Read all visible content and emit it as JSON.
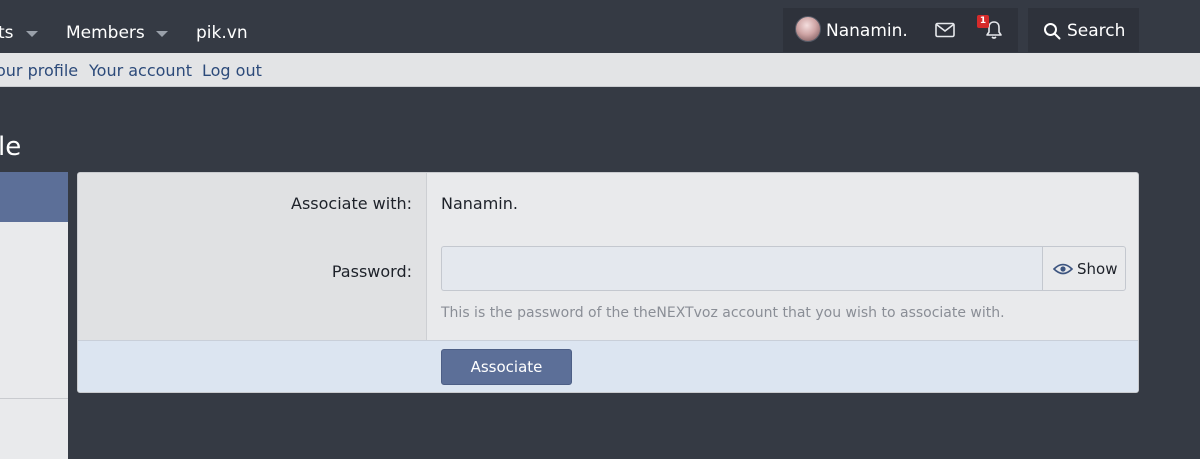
{
  "topbar": {
    "nav_items": [
      {
        "label": "ts",
        "has_dropdown": true
      },
      {
        "label": "Members",
        "has_dropdown": true
      },
      {
        "label": "pik.vn",
        "has_dropdown": false
      }
    ],
    "username": "Nanamin.",
    "notification_count": "1",
    "search_label": "Search"
  },
  "subnav": {
    "links": [
      "our profile",
      "Your account",
      "Log out"
    ]
  },
  "page": {
    "title": "le"
  },
  "form": {
    "associate_label": "Associate with:",
    "associate_value": "Nanamin.",
    "password_label": "Password:",
    "password_value": "",
    "show_label": "Show",
    "hint": "This is the password of the theNEXTvoz account that you wish to associate with.",
    "submit_label": "Associate"
  },
  "colors": {
    "background": "#353a44",
    "accent": "#5c6f98",
    "badge": "#d62b2b"
  }
}
